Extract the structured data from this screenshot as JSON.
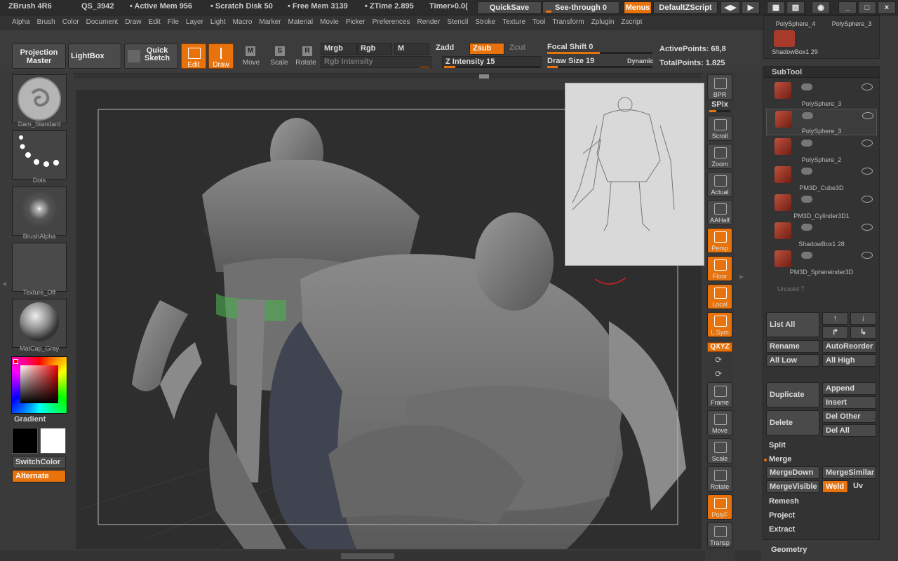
{
  "title": {
    "app": "ZBrush 4R6",
    "file": "QS_3942",
    "active_mem": "• Active Mem 956",
    "scratch": "• Scratch Disk 50",
    "free_mem": "• Free Mem 3139",
    "ztime": "• ZTime 2.895",
    "timer": "Timer»0.0("
  },
  "titlebtns": {
    "quicksave": "QuickSave",
    "seethrough": "See-through",
    "seethrough_val": "0",
    "menus": "Menus",
    "script": "DefaultZScript"
  },
  "menu": [
    "Alpha",
    "Brush",
    "Color",
    "Document",
    "Draw",
    "Edit",
    "File",
    "Layer",
    "Light",
    "Macro",
    "Marker",
    "Material",
    "Movie",
    "Picker",
    "Preferences",
    "Render",
    "Stencil",
    "Stroke",
    "Texture",
    "Tool",
    "Transform",
    "Zplugin",
    "Zscript"
  ],
  "toolbar": {
    "projection": "Projection Master",
    "lightbox": "LightBox",
    "quick": "Quick",
    "sketch": "Sketch",
    "edit": "Edit",
    "draw": "Draw",
    "move": "Move",
    "scale": "Scale",
    "rotate": "Rotate",
    "mrgb": "Mrgb",
    "rgb": "Rgb",
    "m": "M",
    "zadd": "Zadd",
    "zsub": "Zsub",
    "zcut": "Zcut",
    "rgb_intensity": "Rgb Intensity",
    "z_intensity": "Z Intensity",
    "z_intensity_val": "15",
    "focal": "Focal Shift",
    "focal_val": "0",
    "drawsize": "Draw Size",
    "drawsize_val": "19",
    "dynamic": "Dynamic",
    "active_points": "ActivePoints: 68,8",
    "total_points": "TotalPoints: 1.825",
    "z_intensity_pct": 0.12,
    "focal_pct": 0.5,
    "drawsize_pct": 0.1
  },
  "left": {
    "brush": "Dam_Standard",
    "stroke": "Dots",
    "alpha": "BrushAlpha",
    "texture": "Texture_Off",
    "material": "MatCap_Gray",
    "gradient": "Gradient",
    "switchcolor": "SwitchColor",
    "alternate": "Alternate"
  },
  "dock": [
    {
      "name": "bpr",
      "label": "BPR",
      "on": false
    },
    {
      "name": "scroll",
      "label": "Scroll",
      "on": false
    },
    {
      "name": "zoom",
      "label": "Zoom",
      "on": false
    },
    {
      "name": "actual",
      "label": "Actual",
      "on": false
    },
    {
      "name": "aahalf",
      "label": "AAHalf",
      "on": false
    },
    {
      "name": "persp",
      "label": "Persp",
      "on": true
    },
    {
      "name": "floor",
      "label": "Floor",
      "on": true
    },
    {
      "name": "local",
      "label": "Local",
      "on": true
    },
    {
      "name": "lsym",
      "label": "L.Sym",
      "on": true
    },
    {
      "name": "frame",
      "label": "Frame",
      "on": false
    },
    {
      "name": "move",
      "label": "Move",
      "on": false
    },
    {
      "name": "scale",
      "label": "Scale",
      "on": false
    },
    {
      "name": "rotate",
      "label": "Rotate",
      "on": false
    },
    {
      "name": "polyf",
      "label": "PolyF",
      "on": true
    },
    {
      "name": "transp",
      "label": "Transp",
      "on": false
    }
  ],
  "dockextra": {
    "spix": "SPix",
    "xyz": "QXYZ"
  },
  "toptools": [
    "PolySphere_4",
    "PolySphere_3",
    "ShadowBox1 29"
  ],
  "subtool": {
    "title": "SubTool",
    "items": [
      "PolySphere_3",
      "PolySphere_3",
      "PolySphere_2",
      "PM3D_Cube3D",
      "PM3D_Cylinder3D1",
      "ShadowBox1 28",
      "PM3D_Sphereinder3D"
    ],
    "unused": "Unused  7",
    "listall": "List  All",
    "rename": "Rename",
    "autoreorder": "AutoReorder",
    "alllow": "All  Low",
    "allhigh": "All  High",
    "duplicate": "Duplicate",
    "append": "Append",
    "insert": "Insert",
    "delete": "Delete",
    "delother": "Del  Other",
    "delall": "Del  All",
    "split": "Split",
    "merge": "Merge",
    "mergedown": "MergeDown",
    "mergesimilar": "MergeSimilar",
    "mergevisible": "MergeVisible",
    "weld": "Weld",
    "uv": "Uv",
    "remesh": "Remesh",
    "project": "Project",
    "extract": "Extract",
    "geometry": "Geometry"
  },
  "colors": {
    "accent": "#e8720c",
    "bg": "#3a3a3a",
    "primary": "#000000",
    "secondary": "#ffffff"
  }
}
